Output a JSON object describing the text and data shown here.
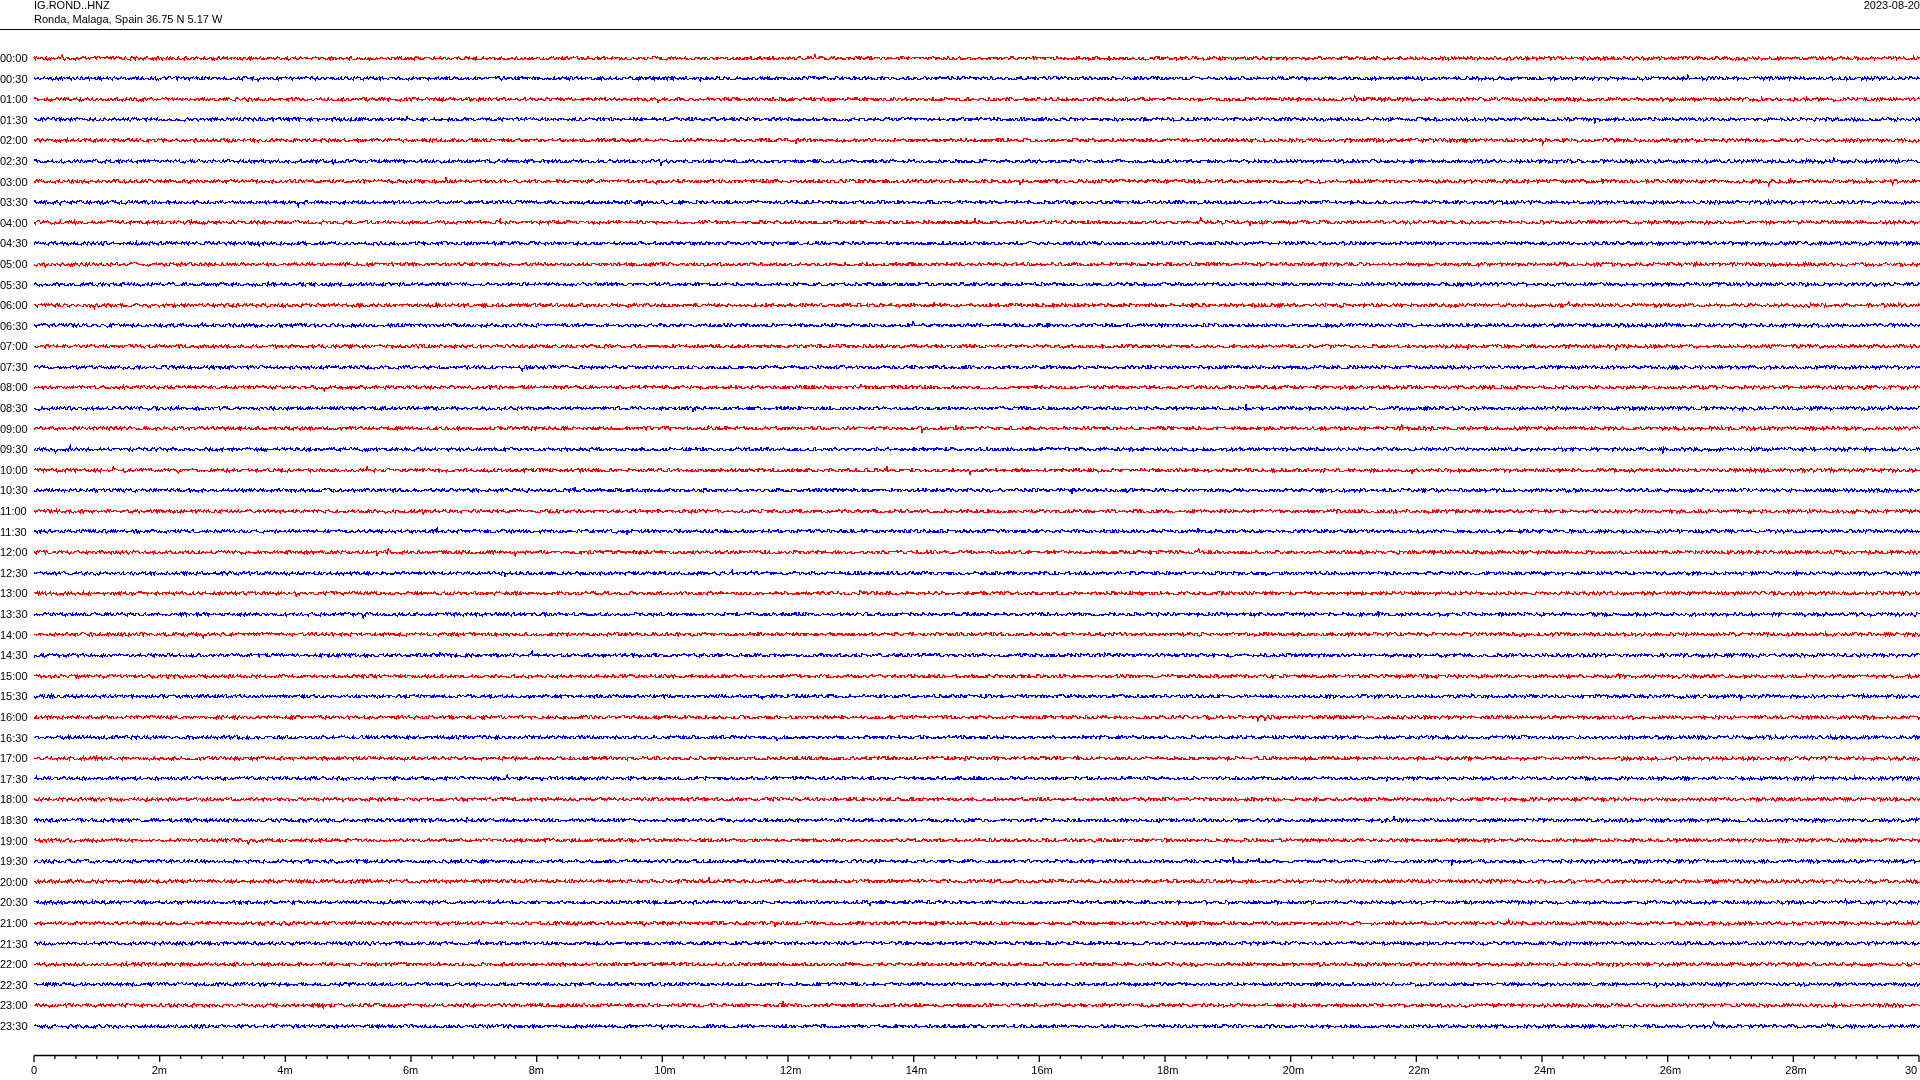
{
  "header": {
    "station": "IG.ROND..HNZ",
    "location": "Ronda, Malaga, Spain  36.75 N 5.17 W",
    "date": "2023-08-20"
  },
  "rows": [
    {
      "label": "00:00",
      "color": "#ff0000"
    },
    {
      "label": "00:30",
      "color": "#0000ff"
    },
    {
      "label": "01:00",
      "color": "#ff0000"
    },
    {
      "label": "01:30",
      "color": "#0000ff"
    },
    {
      "label": "02:00",
      "color": "#ff0000"
    },
    {
      "label": "02:30",
      "color": "#0000ff"
    },
    {
      "label": "03:00",
      "color": "#ff0000"
    },
    {
      "label": "03:30",
      "color": "#0000ff"
    },
    {
      "label": "04:00",
      "color": "#ff0000"
    },
    {
      "label": "04:30",
      "color": "#0000ff"
    },
    {
      "label": "05:00",
      "color": "#ff0000"
    },
    {
      "label": "05:30",
      "color": "#0000ff"
    },
    {
      "label": "06:00",
      "color": "#ff0000"
    },
    {
      "label": "06:30",
      "color": "#0000ff"
    },
    {
      "label": "07:00",
      "color": "#ff0000"
    },
    {
      "label": "07:30",
      "color": "#0000ff"
    },
    {
      "label": "08:00",
      "color": "#ff0000"
    },
    {
      "label": "08:30",
      "color": "#0000ff"
    },
    {
      "label": "09:00",
      "color": "#ff0000"
    },
    {
      "label": "09:30",
      "color": "#0000ff"
    },
    {
      "label": "10:00",
      "color": "#ff0000"
    },
    {
      "label": "10:30",
      "color": "#0000ff"
    },
    {
      "label": "11:00",
      "color": "#ff0000"
    },
    {
      "label": "11:30",
      "color": "#0000ff"
    },
    {
      "label": "12:00",
      "color": "#ff0000"
    },
    {
      "label": "12:30",
      "color": "#0000ff"
    },
    {
      "label": "13:00",
      "color": "#ff0000"
    },
    {
      "label": "13:30",
      "color": "#0000ff"
    },
    {
      "label": "14:00",
      "color": "#ff0000"
    },
    {
      "label": "14:30",
      "color": "#0000ff"
    },
    {
      "label": "15:00",
      "color": "#ff0000"
    },
    {
      "label": "15:30",
      "color": "#0000ff"
    },
    {
      "label": "16:00",
      "color": "#ff0000"
    },
    {
      "label": "16:30",
      "color": "#0000ff"
    },
    {
      "label": "17:00",
      "color": "#ff0000"
    },
    {
      "label": "17:30",
      "color": "#0000ff"
    },
    {
      "label": "18:00",
      "color": "#ff0000"
    },
    {
      "label": "18:30",
      "color": "#0000ff"
    },
    {
      "label": "19:00",
      "color": "#ff0000"
    },
    {
      "label": "19:30",
      "color": "#0000ff"
    },
    {
      "label": "20:00",
      "color": "#ff0000"
    },
    {
      "label": "20:30",
      "color": "#0000ff"
    },
    {
      "label": "21:00",
      "color": "#ff0000"
    },
    {
      "label": "21:30",
      "color": "#0000ff"
    },
    {
      "label": "22:00",
      "color": "#ff0000"
    },
    {
      "label": "22:30",
      "color": "#0000ff"
    },
    {
      "label": "23:00",
      "color": "#ff0000"
    },
    {
      "label": "23:30",
      "color": "#0000ff"
    }
  ],
  "time_axis": {
    "labels": [
      "0",
      "2m",
      "4m",
      "6m",
      "8m",
      "10m",
      "12m",
      "14m",
      "16m",
      "18m",
      "20m",
      "22m",
      "24m",
      "26m",
      "28m",
      "30"
    ]
  }
}
